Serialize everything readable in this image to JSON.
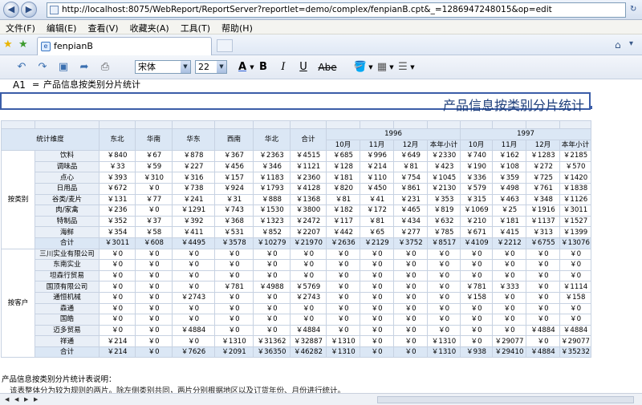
{
  "browser": {
    "url": "http://localhost:8075/WebReport/ReportServer?reportlet=demo/complex/fenpianB.cpt&_=1286947248015&op=edit",
    "menu": [
      "文件(F)",
      "编辑(E)",
      "查看(V)",
      "收藏夹(A)",
      "工具(T)",
      "帮助(H)"
    ],
    "tab_title": "fenpianB"
  },
  "toolbar": {
    "font_name": "宋体",
    "font_size": "22",
    "strike_label": "Abe",
    "bold": "B",
    "italic": "I",
    "underline": "U"
  },
  "formula": {
    "cell_ref": "A1",
    "eq": "=",
    "value": "产品信息按类别分片统计"
  },
  "report": {
    "title": "产品信息按类别分片统计",
    "dim_label": "统计维度",
    "regions": [
      "东北",
      "华南",
      "华东",
      "西南",
      "华北"
    ],
    "total_label": "合计",
    "years": [
      "1996",
      "1997"
    ],
    "months": [
      "10月",
      "11月",
      "12月",
      "本年小计"
    ],
    "groups": [
      {
        "label": "按类别",
        "rows": [
          {
            "name": "饮料",
            "v": [
              "￥840",
              "￥67",
              "￥878",
              "￥367",
              "￥2363",
              "￥4515",
              "￥685",
              "￥996",
              "￥649",
              "￥2330",
              "￥740",
              "￥162",
              "￥1283",
              "￥2185"
            ]
          },
          {
            "name": "调味品",
            "v": [
              "￥33",
              "￥59",
              "￥227",
              "￥456",
              "￥346",
              "￥1121",
              "￥128",
              "￥214",
              "￥81",
              "￥423",
              "￥190",
              "￥108",
              "￥272",
              "￥570"
            ]
          },
          {
            "name": "点心",
            "v": [
              "￥393",
              "￥310",
              "￥316",
              "￥157",
              "￥1183",
              "￥2360",
              "￥181",
              "￥110",
              "￥754",
              "￥1045",
              "￥336",
              "￥359",
              "￥725",
              "￥1420"
            ]
          },
          {
            "name": "日用品",
            "v": [
              "￥672",
              "￥0",
              "￥738",
              "￥924",
              "￥1793",
              "￥4128",
              "￥820",
              "￥450",
              "￥861",
              "￥2130",
              "￥579",
              "￥498",
              "￥761",
              "￥1838"
            ]
          },
          {
            "name": "谷类/麦片",
            "v": [
              "￥131",
              "￥77",
              "￥241",
              "￥31",
              "￥888",
              "￥1368",
              "￥81",
              "￥41",
              "￥231",
              "￥353",
              "￥315",
              "￥463",
              "￥348",
              "￥1126"
            ]
          },
          {
            "name": "肉/家禽",
            "v": [
              "￥236",
              "￥0",
              "￥1291",
              "￥743",
              "￥1530",
              "￥3800",
              "￥182",
              "￥172",
              "￥465",
              "￥819",
              "￥1069",
              "￥25",
              "￥1916",
              "￥3011"
            ]
          },
          {
            "name": "特制品",
            "v": [
              "￥352",
              "￥37",
              "￥392",
              "￥368",
              "￥1323",
              "￥2472",
              "￥117",
              "￥81",
              "￥434",
              "￥632",
              "￥210",
              "￥181",
              "￥1137",
              "￥1527"
            ]
          },
          {
            "name": "海鲜",
            "v": [
              "￥354",
              "￥58",
              "￥411",
              "￥531",
              "￥852",
              "￥2207",
              "￥442",
              "￥65",
              "￥277",
              "￥785",
              "￥671",
              "￥415",
              "￥313",
              "￥1399"
            ]
          }
        ],
        "total": [
          "￥3011",
          "￥608",
          "￥4495",
          "￥3578",
          "￥10279",
          "￥21970",
          "￥2636",
          "￥2129",
          "￥3752",
          "￥8517",
          "￥4109",
          "￥2212",
          "￥6755",
          "￥13076"
        ]
      },
      {
        "label": "按客户",
        "rows": [
          {
            "name": "三川实业有限公司",
            "v": [
              "￥0",
              "￥0",
              "￥0",
              "￥0",
              "￥0",
              "￥0",
              "￥0",
              "￥0",
              "￥0",
              "￥0",
              "￥0",
              "￥0",
              "￥0",
              "￥0"
            ]
          },
          {
            "name": "东南实业",
            "v": [
              "￥0",
              "￥0",
              "￥0",
              "￥0",
              "￥0",
              "￥0",
              "￥0",
              "￥0",
              "￥0",
              "￥0",
              "￥0",
              "￥0",
              "￥0",
              "￥0"
            ]
          },
          {
            "name": "坦森行贸易",
            "v": [
              "￥0",
              "￥0",
              "￥0",
              "￥0",
              "￥0",
              "￥0",
              "￥0",
              "￥0",
              "￥0",
              "￥0",
              "￥0",
              "￥0",
              "￥0",
              "￥0"
            ]
          },
          {
            "name": "国顶有限公司",
            "v": [
              "￥0",
              "￥0",
              "￥0",
              "￥781",
              "￥4988",
              "￥5769",
              "￥0",
              "￥0",
              "￥0",
              "￥0",
              "￥781",
              "￥333",
              "￥0",
              "￥1114"
            ]
          },
          {
            "name": "通恒机械",
            "v": [
              "￥0",
              "￥0",
              "￥2743",
              "￥0",
              "￥0",
              "￥2743",
              "￥0",
              "￥0",
              "￥0",
              "￥0",
              "￥158",
              "￥0",
              "￥0",
              "￥158"
            ]
          },
          {
            "name": "森通",
            "v": [
              "￥0",
              "￥0",
              "￥0",
              "￥0",
              "￥0",
              "￥0",
              "￥0",
              "￥0",
              "￥0",
              "￥0",
              "￥0",
              "￥0",
              "￥0",
              "￥0"
            ]
          },
          {
            "name": "国皓",
            "v": [
              "￥0",
              "￥0",
              "￥0",
              "￥0",
              "￥0",
              "￥0",
              "￥0",
              "￥0",
              "￥0",
              "￥0",
              "￥0",
              "￥0",
              "￥0",
              "￥0"
            ]
          },
          {
            "name": "迈多贸易",
            "v": [
              "￥0",
              "￥0",
              "￥4884",
              "￥0",
              "￥0",
              "￥4884",
              "￥0",
              "￥0",
              "￥0",
              "￥0",
              "￥0",
              "￥0",
              "￥4884",
              "￥4884"
            ]
          },
          {
            "name": "祥通",
            "v": [
              "￥214",
              "￥0",
              "￥0",
              "￥1310",
              "￥31362",
              "￥32887",
              "￥1310",
              "￥0",
              "￥0",
              "￥1310",
              "￥0",
              "￥29077",
              "￥0",
              "￥29077"
            ]
          }
        ],
        "total": [
          "￥214",
          "￥0",
          "￥7626",
          "￥2091",
          "￥36350",
          "￥46282",
          "￥1310",
          "￥0",
          "￥0",
          "￥1310",
          "￥938",
          "￥29410",
          "￥4884",
          "￥35232"
        ]
      }
    ],
    "note_title": "产品信息按类别分片统计表说明：",
    "note_body": "该表整体分为较为规则的两片。除左侧类别共同，两片分别根据地区以及订货年份、月份进行统计。"
  }
}
